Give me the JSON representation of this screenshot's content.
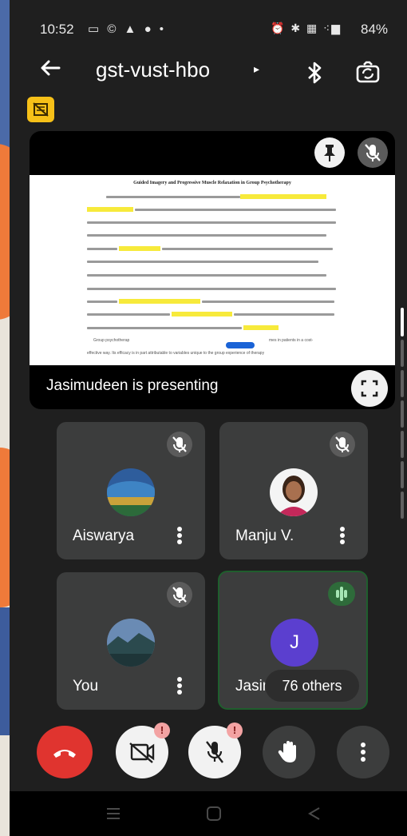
{
  "status_bar": {
    "time": "10:52",
    "notification_icons": "▭ © ▲ ● •",
    "system_icons": "⏰ ✱ ▦ ⁖▆",
    "battery": "84%"
  },
  "meeting": {
    "code": "gst-vust-hbo",
    "caret": "▸"
  },
  "presentation": {
    "label": "Jasimudeen is presenting",
    "doc_title": "Guided Imagery and Progressive Muscle Relaxation in Group Psychotherapy",
    "doc_footer_left": "Group psychotherap",
    "doc_footer_right": "mes in patients in a cost-",
    "doc_last_line": "effective way. Its efficacy is in part attributable to variables unique to the group experience of therapy"
  },
  "participants": [
    {
      "name": "Aiswarya",
      "muted": true
    },
    {
      "name": "Manju V.",
      "muted": true
    },
    {
      "name": "You",
      "muted": true
    },
    {
      "name": "Jasimudeen",
      "display_name": "Jasim",
      "avatar_letter": "J",
      "speaking": true
    }
  ],
  "others_chip": "76 others",
  "controls": {
    "end_call": "end-call",
    "camera": "camera-off",
    "mic": "mic-off",
    "raise_hand": "raise-hand",
    "more": "more-options",
    "warning_mark": "!"
  },
  "colors": {
    "end_call": "#e0342f",
    "background": "#1f1f1f",
    "tile": "#3c3d3d",
    "speaking": "#2e6b3a",
    "avatar_j": "#5b3fcf",
    "recording_badge": "#f6c018",
    "highlight": "#f7ea3b"
  }
}
